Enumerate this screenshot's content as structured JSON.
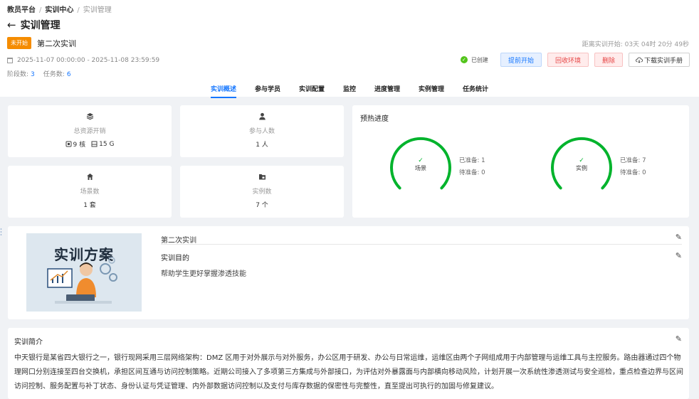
{
  "breadcrumb": {
    "root": "教员平台",
    "mid": "实训中心",
    "current": "实训管理"
  },
  "page_title": "实训管理",
  "training": {
    "status_tag": "未开始",
    "name": "第二次实训",
    "countdown": "距离实训开始: 03天 04时 20分 49秒",
    "time_range": "2025-11-07 00:00:00 - 2025-11-08 23:59:59",
    "stage_label": "阶段数:",
    "stage_count": "3",
    "task_label": "任务数:",
    "task_count": "6"
  },
  "actions": {
    "created_label": "已创建",
    "start_early": "提前开始",
    "reclaim_env": "回收环境",
    "delete": "删除",
    "download_manual": "下载实训手册"
  },
  "tabs": [
    "实训概述",
    "参与学员",
    "实训配置",
    "监控",
    "进度管理",
    "实例管理",
    "任务统计"
  ],
  "stats": {
    "resource_label": "总资源开销",
    "cpu_value": "9 核",
    "mem_value": "15 G",
    "participants_label": "参与人数",
    "participants_value": "1 人",
    "scenes_label": "场景数",
    "scenes_value": "1 套",
    "instances_label": "实例数",
    "instances_value": "7 个"
  },
  "warmup": {
    "title": "预热进度",
    "scene": {
      "label": "场景",
      "ready_label": "已准备:",
      "ready": "1",
      "pending_label": "待准备:",
      "pending": "0",
      "progress": 1
    },
    "instance": {
      "label": "实例",
      "ready_label": "已准备:",
      "ready": "7",
      "pending_label": "待准备:",
      "pending": "0",
      "progress": 1
    }
  },
  "plan": {
    "thumb_title": "实训方案",
    "name": "第二次实训",
    "purpose_label": "实训目的",
    "purpose": "帮助学生更好掌握渗透技能"
  },
  "intro": {
    "title": "实训简介",
    "text": "中天银行是某省四大银行之一，银行现网采用三层网络架构：DMZ 区用于对外展示与对外服务，办公区用于研发、办公与日常运维，运维区由两个子网组成用于内部管理与运维工具与主控服务。路由器通过四个物理网口分别连接至四台交换机，承担区间互通与访问控制策略。近期公司接入了多项第三方集成与外部接口，为评估对外暴露面与内部横向移动风险，计划开展一次系统性渗透测试与安全巡检，重点检查边界与区间访问控制、服务配置与补丁状态、身份认证与凭证管理、内外部数据访问控制以及支付与库存数据的保密性与完整性，直至提出可执行的加固与修复建议。"
  },
  "colors": {
    "accent": "#1677ff",
    "warning": "#f58c00",
    "danger": "#e64545",
    "success": "#52c41a"
  }
}
